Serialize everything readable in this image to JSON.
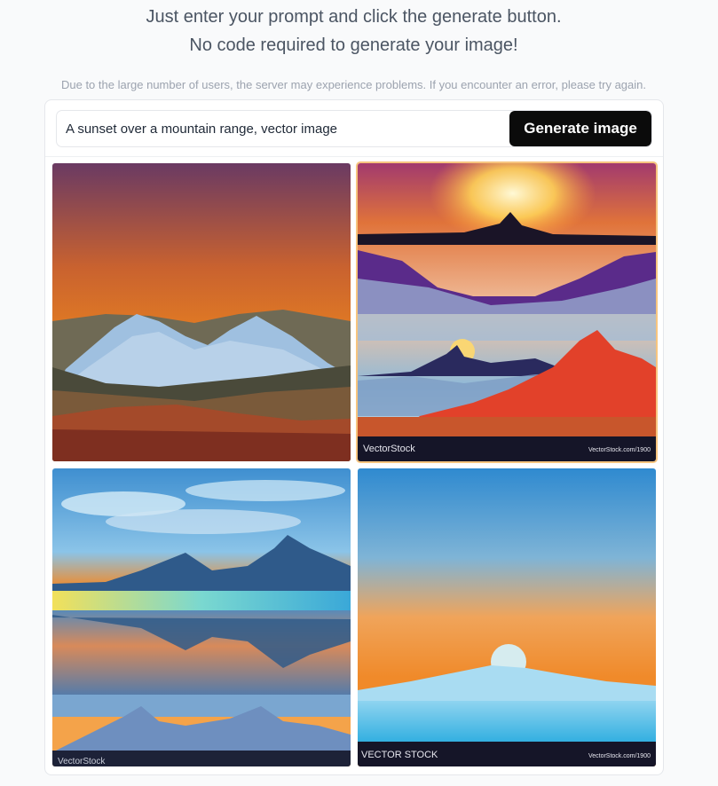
{
  "header": {
    "line1": "Just enter your prompt and click the generate button.",
    "line2": "No code required to generate your image!",
    "notice": "Due to the large number of users, the server may experience problems. If you encounter an error, please try again."
  },
  "prompt": {
    "value": "A sunset over a mountain range, vector image"
  },
  "generate_button": {
    "label": "Generate image"
  },
  "images": [
    {
      "name": "generated-image-1",
      "selected": false,
      "watermark_left": "",
      "watermark_right": ""
    },
    {
      "name": "generated-image-2",
      "selected": true,
      "watermark_left": "VectorStock",
      "watermark_right": "VectorStock.com/1900"
    },
    {
      "name": "generated-image-3",
      "selected": false,
      "watermark_left": "VectorStock",
      "watermark_right": ""
    },
    {
      "name": "generated-image-4",
      "selected": false,
      "watermark_left": "VECTOR STOCK",
      "watermark_right": "VectorStock.com/1900"
    }
  ],
  "colors": {
    "button_bg": "#0b0b0b",
    "selected_border": "#f7c57f",
    "page_bg": "#f9fafb"
  }
}
